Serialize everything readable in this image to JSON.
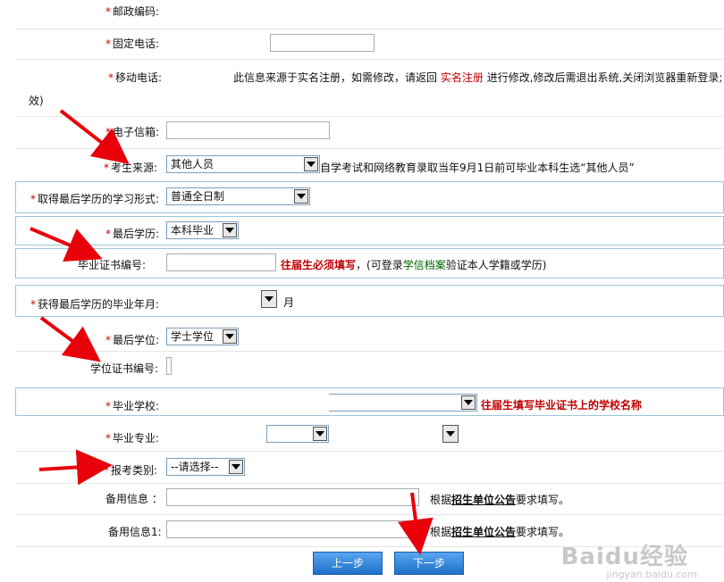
{
  "form": {
    "postal_code_label": "邮政编码:",
    "phone_label": "固定电话:",
    "mobile_label": "移动电话:",
    "mobile_note_1": "此信息来源于实名注册，如需修改，请返回",
    "mobile_note_link": "实名注册",
    "mobile_note_2": "进行修改,修改后需退出系统,关闭浏览器重新登录;",
    "mobile_note_cont": "效)",
    "email_label": "电子信箱:",
    "source_label": "考生来源:",
    "source_value": "其他人员",
    "source_note": "自学考试和网络教育录取当年9月1日前可毕业本科生选“其他人员”",
    "study_form_label": "取得最后学历的学习形式:",
    "study_form_value": "普通全日制",
    "last_degree_edu_label": "最后学历:",
    "last_degree_edu_value": "本科毕业",
    "cert_no_label": "毕业证书编号:",
    "cert_note_red": "往届生必须填写",
    "cert_note_1": "，(可登录",
    "cert_note_link": "学信档案",
    "cert_note_2": "验证本人学籍或学历)",
    "grad_date_label": "获得最后学历的毕业年月:",
    "grad_month_suffix": "月",
    "last_degree_label": "最后学位:",
    "last_degree_value": "学士学位",
    "degree_cert_label": "学位证书编号:",
    "school_label": "毕业学校:",
    "school_note": "往届生填写毕业证书上的学校名称",
    "major_label": "毕业专业:",
    "exam_type_label": "报考类别:",
    "exam_type_value": "--请选择--",
    "backup_label": "备用信息 ：",
    "backup_note_1": "根据",
    "backup_note_link": "招生单位公告",
    "backup_note_2": "要求填写。",
    "backup1_label": "备用信息1:",
    "backup1_note_1": "根据",
    "backup1_note_link": "招生单位公告",
    "backup1_note_2": "要求填写。",
    "required_mark": "*"
  },
  "buttons": {
    "prev": "上一步",
    "next": "下一步"
  },
  "watermark": {
    "main": "Baidu经验",
    "sub": "jingyan.baidu.com"
  },
  "colors": {
    "required": "#d00000",
    "highlight": "#c00000",
    "link_green": "#006600",
    "button": "#2b7fd6",
    "annotation": "#e8000b"
  }
}
